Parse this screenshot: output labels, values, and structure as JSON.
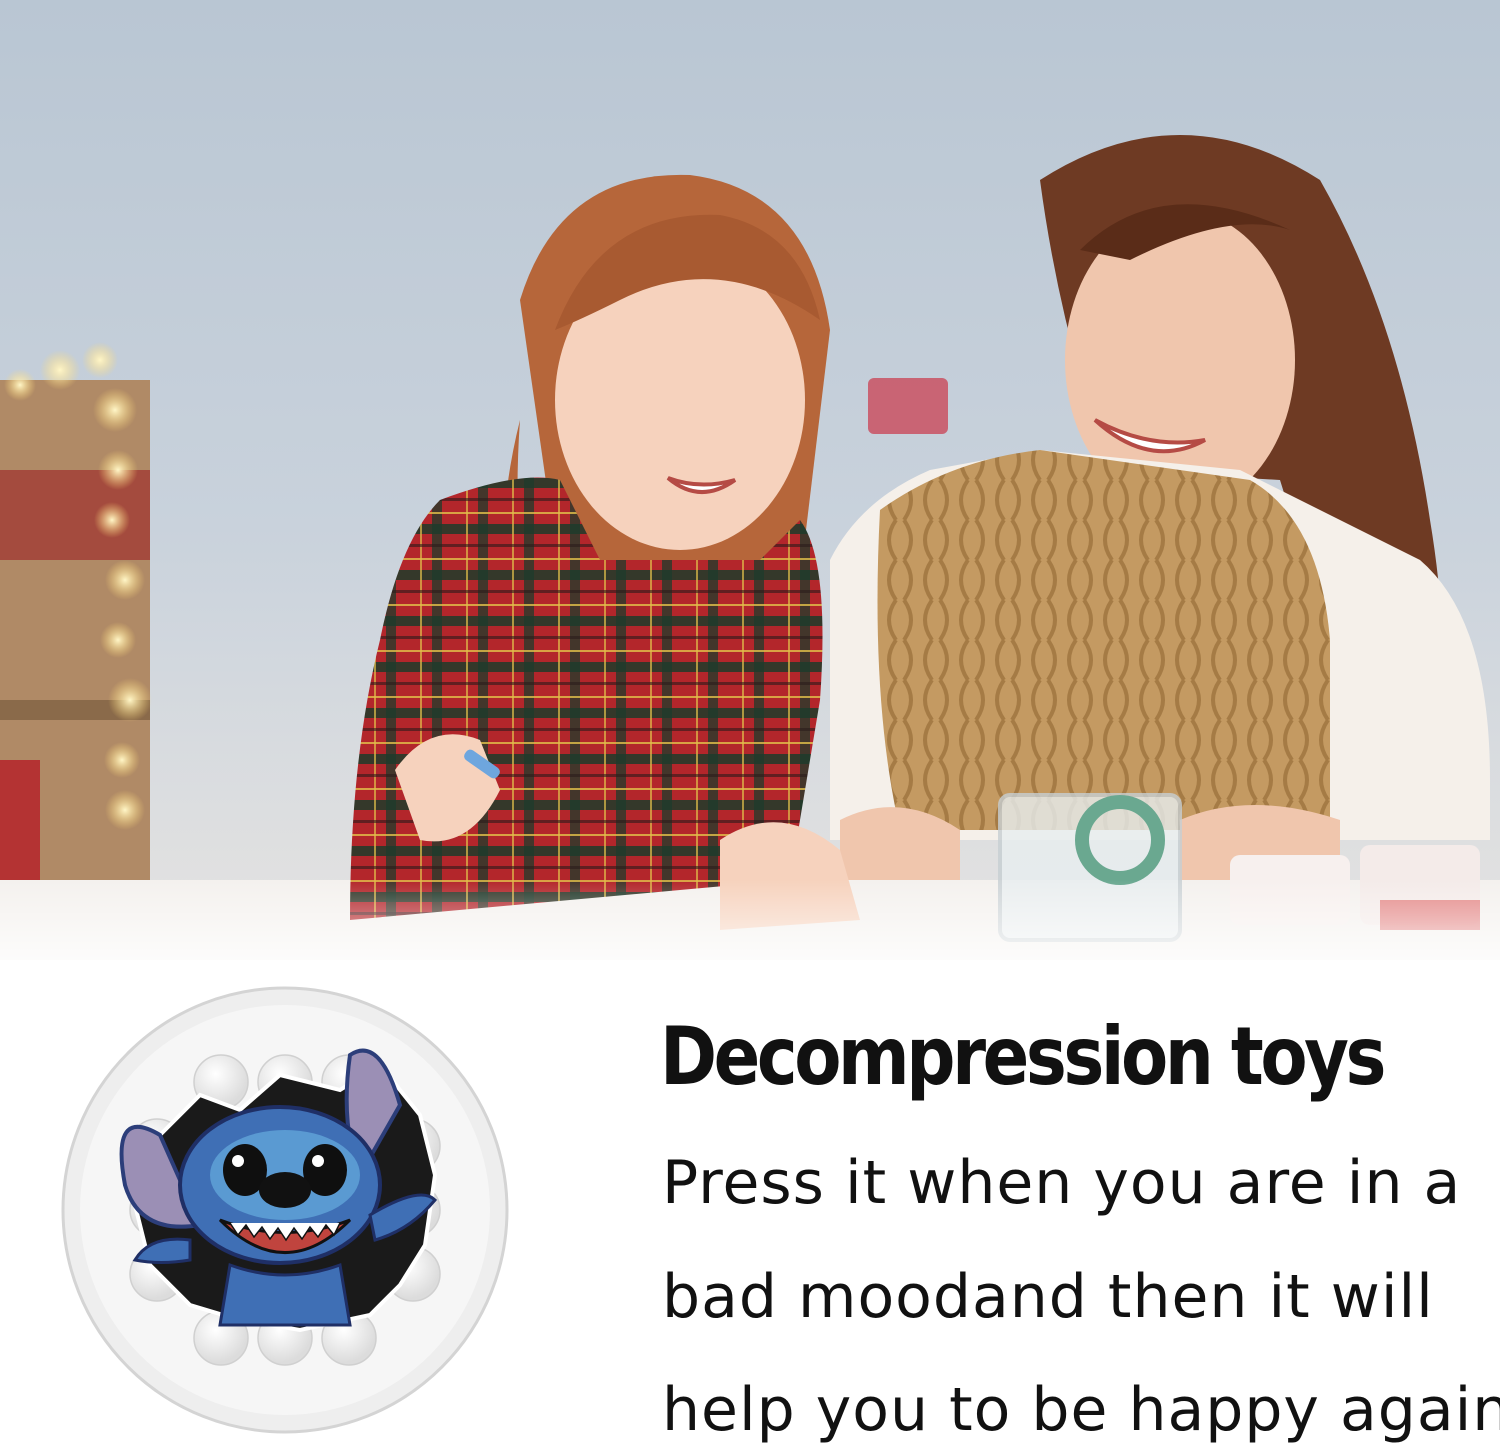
{
  "headline": "Decompression toys",
  "body_lines": [
    "Press it when you are in a",
    "bad moodand then it will",
    "help you to be happy again."
  ],
  "colors": {
    "background": "#ffffff",
    "text": "#111111",
    "toy_white": "#f2f2f2",
    "stitch_blue": "#3f6fb5",
    "plaid_red": "#b3262b",
    "sweater_tan": "#c49a62"
  },
  "icons": {
    "photo": "mother-and-daughter-drawing-photo",
    "toy": "round-push-pop-fidget-toy-with-blue-alien-character"
  }
}
